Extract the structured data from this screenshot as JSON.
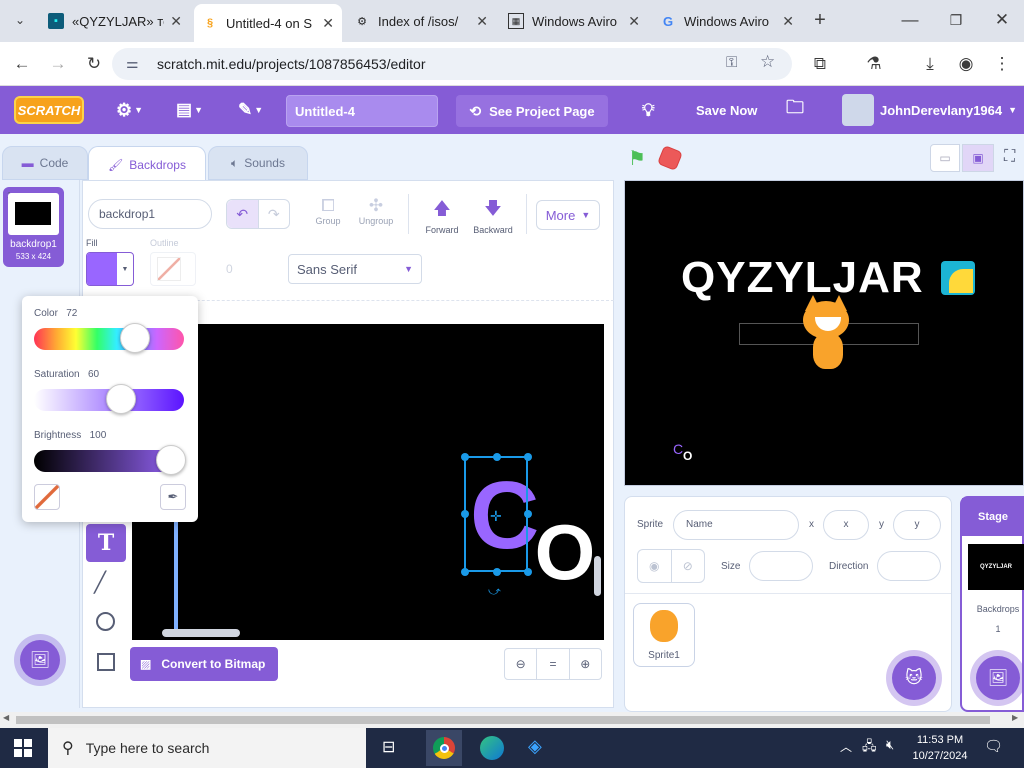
{
  "browser": {
    "tabs": [
      {
        "title": "«QYZYLJAR» те",
        "icon": "qyzyljar-favicon"
      },
      {
        "title": "Untitled-4 on S",
        "icon": "scratch-favicon"
      },
      {
        "title": "Index of /isos/",
        "icon": "index-favicon"
      },
      {
        "title": "Windows Aviro",
        "icon": "windows-favicon"
      },
      {
        "title": "Windows Aviro",
        "icon": "google-favicon"
      }
    ],
    "url": "scratch.mit.edu/projects/1087856453/editor"
  },
  "menu": {
    "logo": "SCRATCH",
    "project_title": "Untitled-4",
    "see_project": "See Project Page",
    "save_now": "Save Now",
    "username": "JohnDerevlany1964"
  },
  "editor_tabs": {
    "code": "Code",
    "backdrops": "Backdrops",
    "sounds": "Sounds"
  },
  "costume": {
    "index": "1",
    "name": "backdrop1",
    "size": "533 x 424"
  },
  "paint": {
    "name_value": "backdrop1",
    "group": "Group",
    "ungroup": "Ungroup",
    "forward": "Forward",
    "backward": "Backward",
    "more": "More",
    "fill_label": "Fill",
    "outline_label": "Outline",
    "outline_width": "0",
    "font": "Sans Serif",
    "convert": "Convert to Bitmap",
    "fill_color": "#9966ff",
    "canvas_text_1": "C",
    "canvas_text_2": "O"
  },
  "color_picker": {
    "color_label": "Color",
    "color_value": "72",
    "saturation_label": "Saturation",
    "saturation_value": "60",
    "brightness_label": "Brightness",
    "brightness_value": "100"
  },
  "stage": {
    "heading": "QYZYLJAR",
    "small_text_1": "C",
    "small_text_2": "O"
  },
  "sprite_info": {
    "sprite_label": "Sprite",
    "name_placeholder": "Name",
    "x_label": "x",
    "x_placeholder": "x",
    "y_label": "y",
    "y_placeholder": "y",
    "show_label": "",
    "size_label": "Size",
    "direction_label": "Direction",
    "sprite_name": "Sprite1"
  },
  "stage_panel": {
    "title": "Stage",
    "backdrops_label": "Backdrops",
    "backdrops_count": "1",
    "thumb_text": "QYZYLJAR"
  },
  "taskbar": {
    "search_placeholder": "Type here to search",
    "time": "11:53 PM",
    "date": "10/27/2024"
  }
}
